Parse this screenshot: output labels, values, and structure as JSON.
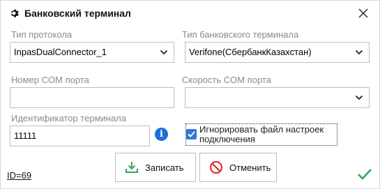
{
  "window": {
    "title": "Банковский терминал"
  },
  "protocol": {
    "label": "Тип протокола",
    "value": "InpasDualConnector_1"
  },
  "terminal_type": {
    "label": "Тип банковского терминала",
    "value": "Verifone(СбербанкКазахстан)"
  },
  "com_port": {
    "label": "Номер COM порта",
    "value": ""
  },
  "com_speed": {
    "label": "Скорость COM порта",
    "value": ""
  },
  "terminal_id": {
    "label": "Идентификатор терминала",
    "value": "11111"
  },
  "ignore_settings": {
    "label": "Игнорировать файл настроек подключения",
    "checked": true
  },
  "buttons": {
    "save": "Записать",
    "cancel": "Отменить"
  },
  "footer": {
    "id_text": "ID=69"
  },
  "colors": {
    "accent": "#2f78d6",
    "save_green": "#2fa84f",
    "cancel_red": "#e02020"
  },
  "icons": {
    "title": "gear-icon",
    "close": "close-icon",
    "info": "info-icon",
    "check": "checkmark-icon",
    "save": "download-icon",
    "cancel": "no-entry-icon"
  }
}
